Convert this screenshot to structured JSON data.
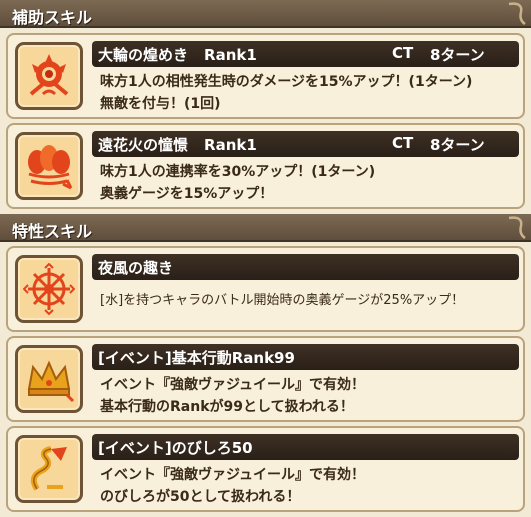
{
  "support_section": {
    "title": "補助スキル",
    "skills": [
      {
        "name": "大輪の煌めき",
        "rank": "Rank1",
        "ct_label": "CT",
        "turns": "8ターン",
        "lines": [
          "味方1人の相性発生時のダメージを15%アップ！(1ターン)",
          "無敵を付与！(1回)"
        ],
        "icon": "firework-flower-icon"
      },
      {
        "name": "遠花火の憧憬",
        "rank": "Rank1",
        "ct_label": "CT",
        "turns": "8ターン",
        "lines": [
          "味方1人の連携率を30%アップ！(1ターン)",
          "奥義ゲージを15%アップ！"
        ],
        "icon": "bloom-burst-icon"
      }
    ]
  },
  "trait_section": {
    "title": "特性スキル",
    "skills": [
      {
        "name": "夜風の趣き",
        "lines": [
          "[水]を持つキャラのバトル開始時の奥義ゲージが25%アップ！"
        ],
        "icon": "snowflake-wheel-icon"
      },
      {
        "name": "[イベント]基本行動Rank99",
        "lines": [
          "イベント『強敵ヴァジュイール』で有効！",
          "基本行動のRankが99として扱われる！"
        ],
        "icon": "crown-icon"
      },
      {
        "name": "[イベント]のびしろ50",
        "lines": [
          "イベント『強敵ヴァジュイール』で有効！",
          "のびしろが50として扱われる！"
        ],
        "icon": "spiral-arrow-icon"
      }
    ]
  }
}
